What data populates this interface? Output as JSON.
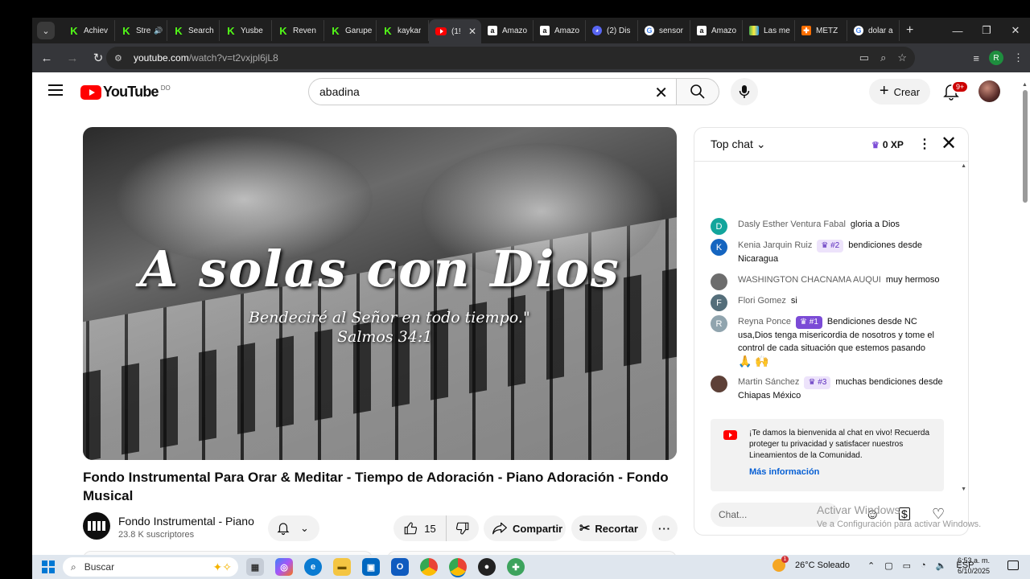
{
  "browser": {
    "tabs": [
      {
        "label": "Achiev",
        "icon": "kick-icon",
        "active": false
      },
      {
        "label": "Stre",
        "icon": "kick-icon",
        "active": false,
        "audio": true
      },
      {
        "label": "Search",
        "icon": "kick-icon",
        "active": false
      },
      {
        "label": "Yusbe",
        "icon": "kick-icon",
        "active": false
      },
      {
        "label": "Reven",
        "icon": "kick-icon",
        "active": false
      },
      {
        "label": "Garupe",
        "icon": "kick-icon",
        "active": false
      },
      {
        "label": "kaykar",
        "icon": "kick-icon",
        "active": false
      },
      {
        "label": "(1!",
        "icon": "youtube-icon",
        "active": true
      },
      {
        "label": "Amazo",
        "icon": "amazon-icon",
        "active": false
      },
      {
        "label": "Amazo",
        "icon": "amazon-icon",
        "active": false
      },
      {
        "label": "(2) Dis",
        "icon": "discord-icon",
        "active": false
      },
      {
        "label": "sensor",
        "icon": "google-icon",
        "active": false
      },
      {
        "label": "Amazo",
        "icon": "amazon-icon",
        "active": false
      },
      {
        "label": "Las me",
        "icon": "las-icon",
        "active": false
      },
      {
        "label": "METZ",
        "icon": "metz-icon",
        "active": false
      },
      {
        "label": "dolar a",
        "icon": "google-icon",
        "active": false
      }
    ],
    "url_host": "youtube.com",
    "url_path": "/watch?v=t2vxjpl6jL8",
    "profile_initial": "R"
  },
  "youtube": {
    "logo_text": "YouTube",
    "country_code": "DO",
    "search_value": "abadina",
    "create_label": "Crear",
    "notifications_badge": "9+"
  },
  "video": {
    "overlay_title": "A solas con Dios",
    "overlay_line1": "Bendeciré al Señor en todo tiempo.\"",
    "overlay_line2": "Salmos 34:1",
    "title": "Fondo Instrumental Para Orar & Meditar - Tiempo de Adoración - Piano Adoración - Fondo Musical",
    "channel_name": "Fondo Instrumental - Piano",
    "subscribers": "23.8 K suscriptores",
    "likes": "15",
    "share_label": "Compartir",
    "clip_label": "Recortar"
  },
  "chat": {
    "mode_label": "Top chat",
    "xp_label": "0 XP",
    "messages": [
      {
        "initial": "D",
        "avatar_color": "#12a59c",
        "author": "Dasly Esther Ventura Fabal",
        "badge": "",
        "text": "gloria a Dios",
        "emoji": ""
      },
      {
        "initial": "K",
        "avatar_color": "#1565c0",
        "author": "Kenia Jarquin Ruiz",
        "badge": "#2",
        "text": "bendiciones desde Nicaragua",
        "emoji": ""
      },
      {
        "initial": "",
        "avatar_color": "#6d6d6d",
        "author": "WASHINGTON CHACNAMA AUQUI",
        "badge": "",
        "text": "muy hermoso",
        "emoji": ""
      },
      {
        "initial": "F",
        "avatar_color": "#546e7a",
        "author": "Flori Gomez",
        "badge": "",
        "text": "si",
        "emoji": ""
      },
      {
        "initial": "R",
        "avatar_color": "#90a4ae",
        "author": "Reyna Ponce",
        "badge": "#1",
        "text": "Bendiciones desde NC usa,Dios tenga misericordia de nosotros y tome el control de cada situación que estemos pasando",
        "emoji": "🙏 🙌"
      },
      {
        "initial": "",
        "avatar_color": "#5d4037",
        "author": "Martin Sánchez",
        "badge": "#3",
        "text": "muchas bendiciones desde Chiapas México",
        "emoji": ""
      }
    ],
    "welcome_text": "¡Te damos la bienvenida al chat en vivo! Recuerda proteger tu privacidad y satisfacer nuestros Lineamientos de la Comunidad.",
    "welcome_link": "Más información",
    "input_placeholder": "Chat..."
  },
  "watermark": {
    "line1": "Activar Windows",
    "line2": "Ve a Configuración para activar Windows."
  },
  "taskbar": {
    "search_placeholder": "Buscar",
    "weather": "26°C  Soleado",
    "language": "ESP",
    "time": "6:53 a. m.",
    "date": "6/10/2025",
    "weather_badge": "1"
  }
}
